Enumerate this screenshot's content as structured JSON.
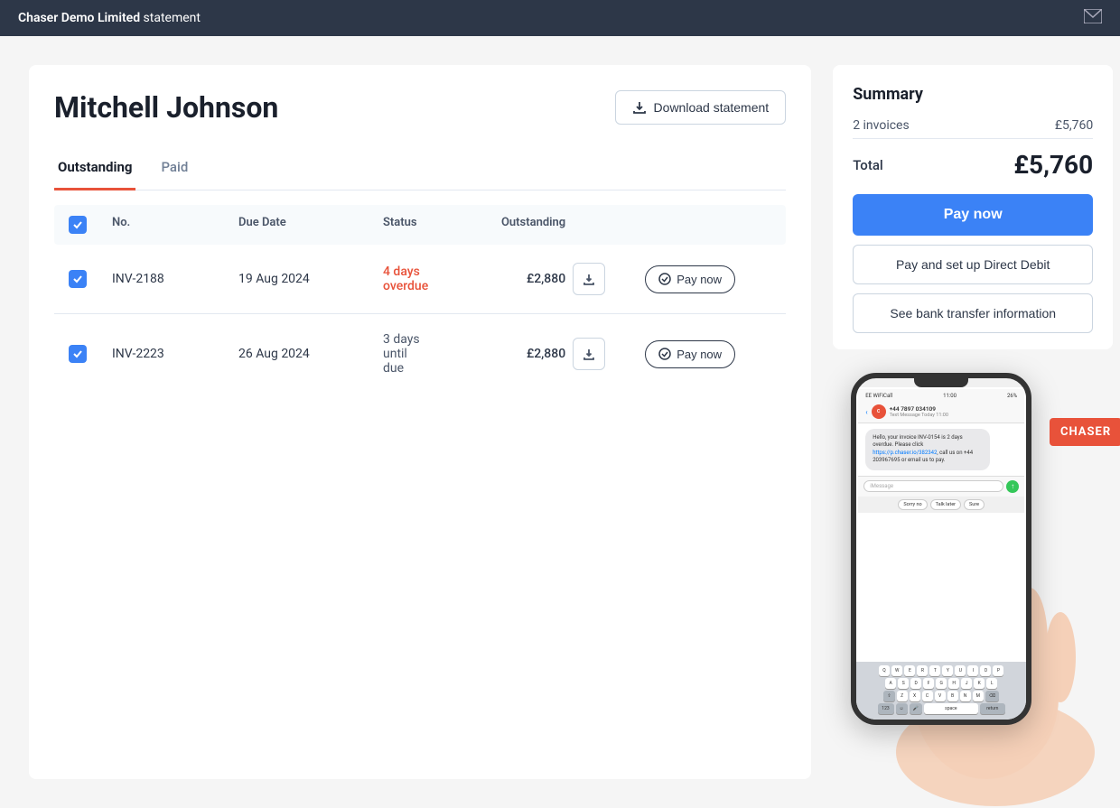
{
  "topNav": {
    "brand": "Chaser Demo Limited",
    "brandSuffix": " statement",
    "mailIconLabel": "mail"
  },
  "header": {
    "clientName": "Mitchell Johnson",
    "downloadLabel": "Download statement",
    "downloadIcon": "download-icon"
  },
  "tabs": [
    {
      "id": "outstanding",
      "label": "Outstanding",
      "active": true
    },
    {
      "id": "paid",
      "label": "Paid",
      "active": false
    }
  ],
  "table": {
    "columns": [
      "",
      "No.",
      "Due Date",
      "Status",
      "Outstanding",
      "",
      ""
    ],
    "rows": [
      {
        "checked": true,
        "number": "INV-2188",
        "dueDate": "19 Aug 2024",
        "status": "4 days overdue",
        "statusType": "overdue",
        "outstanding": "£2,880",
        "payLabel": "Pay now"
      },
      {
        "checked": true,
        "number": "INV-2223",
        "dueDate": "26 Aug 2024",
        "status": "3 days until due",
        "statusType": "due",
        "outstanding": "£2,880",
        "payLabel": "Pay now"
      }
    ]
  },
  "summary": {
    "title": "Summary",
    "invoiceCount": "2 invoices",
    "invoiceAmount": "£5,760",
    "totalLabel": "Total",
    "totalAmount": "£5,760",
    "payNowLabel": "Pay now",
    "directDebitLabel": "Pay and set up Direct Debit",
    "seeInfoLabel": "See bank transfer information"
  },
  "chaserLogo": "CHASER",
  "phone": {
    "time": "11:00",
    "signal": "EE WiFiCall",
    "battery": "26%",
    "contactName": "+44 7897 034109",
    "subLabel": "Text Message Today 11:00",
    "message": "Hello, your invoice INV-0154 is 2 days overdue. Please click https://p.chaser.io/382342, call us on +44 203967695 or email us to pay.",
    "linkText": "https://p.chaser.io/382342",
    "placeholder": "iMessage",
    "quickReplies": [
      "Sorry no",
      "Talk later",
      "Sure"
    ],
    "keyboard": {
      "row1": [
        "Q",
        "W",
        "E",
        "R",
        "T",
        "Y",
        "U",
        "I",
        "O",
        "P"
      ],
      "row2": [
        "A",
        "S",
        "D",
        "F",
        "G",
        "H",
        "J",
        "K",
        "L"
      ],
      "row3": [
        "Z",
        "X",
        "C",
        "V",
        "B",
        "N",
        "M"
      ],
      "row4": [
        "123",
        "space",
        "return"
      ]
    }
  }
}
